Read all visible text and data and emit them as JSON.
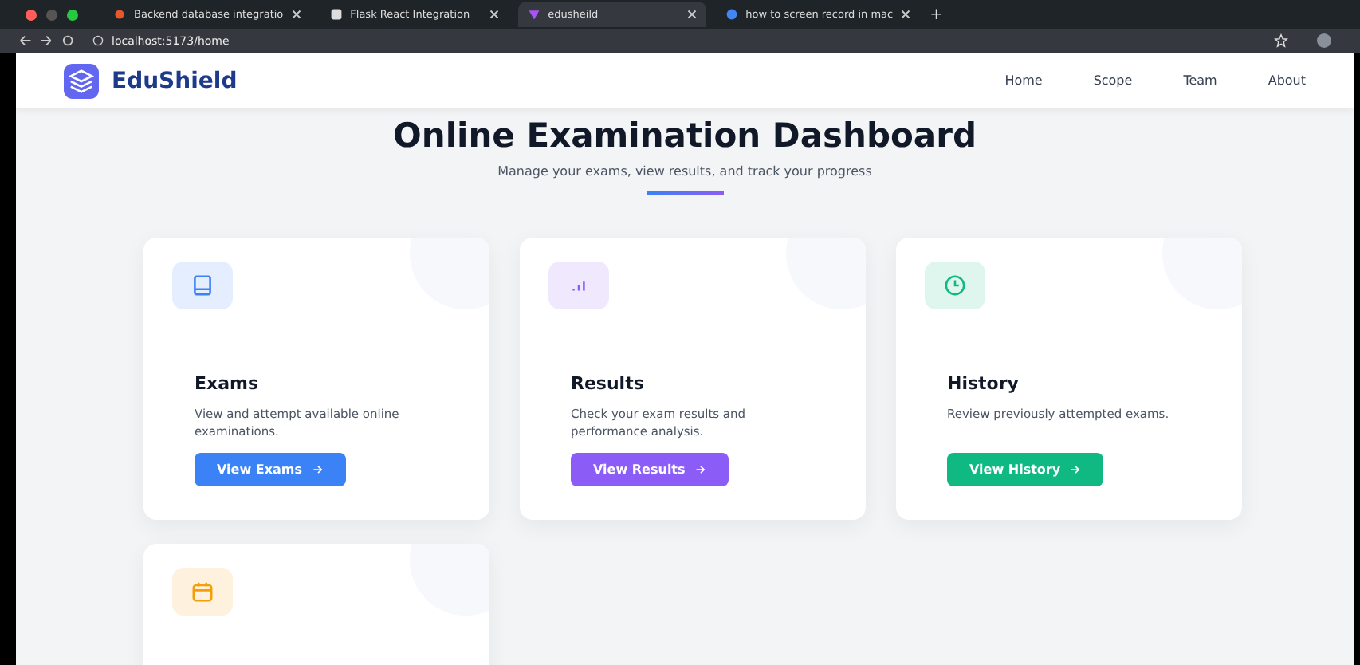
{
  "browser": {
    "tabs": [
      {
        "title": "Backend database integratio",
        "kind": "asterisk",
        "selected": false
      },
      {
        "title": "Flask React Integration",
        "kind": "square",
        "selected": false
      },
      {
        "title": "edusheild",
        "kind": "heart",
        "selected": true
      },
      {
        "title": "how to screen record in mac",
        "kind": "globe",
        "selected": false
      }
    ],
    "new_tab": "+",
    "address": "localhost:5173/home"
  },
  "navbar": {
    "brand": "EduShield",
    "links": [
      "Home",
      "Scope",
      "Team",
      "About"
    ]
  },
  "header": {
    "title": "Online Examination Dashboard",
    "subtitle": "Manage your exams, view results, and track your progress"
  },
  "cards": [
    {
      "kind": "book",
      "color": "#3b82f6",
      "title": "Exams",
      "description": "View and attempt available online examinations.",
      "button": "View Exams"
    },
    {
      "kind": "chart",
      "color": "#8b5cf6",
      "title": "Results",
      "description": "Check your exam results and performance analysis.",
      "button": "View Results"
    },
    {
      "kind": "clock",
      "color": "#10b981",
      "title": "History",
      "description": "Review previously attempted exams.",
      "button": "View History"
    },
    {
      "kind": "calendar",
      "color": "#f59e0b"
    }
  ]
}
